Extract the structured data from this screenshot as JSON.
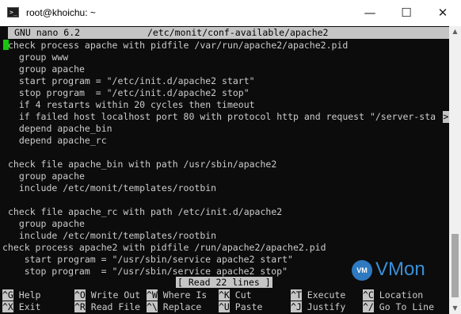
{
  "window": {
    "title": "root@khoichu: ~",
    "app_icon_glyph": ">_",
    "minimize_glyph": "—",
    "maximize_glyph": "☐",
    "close_glyph": "✕"
  },
  "nano": {
    "version": "GNU nano 6.2",
    "filename": "/etc/monit/conf-available/apache2",
    "overflow_marker": ">",
    "status_message": "[ Read 22 lines ]"
  },
  "editor_lines": [
    "check process apache with pidfile /var/run/apache2/apache2.pid",
    "  group www",
    "  group apache",
    "  start program = \"/etc/init.d/apache2 start\"",
    "  stop program  = \"/etc/init.d/apache2 stop\"",
    "  if 4 restarts within 20 cycles then timeout",
    "  if failed host localhost port 80 with protocol http and request \"/server-sta",
    "  depend apache_bin",
    "  depend apache_rc",
    "",
    "check file apache_bin with path /usr/sbin/apache2",
    "  group apache",
    "  include /etc/monit/templates/rootbin",
    "",
    "check file apache_rc with path /etc/init.d/apache2",
    "  group apache",
    "  include /etc/monit/templates/rootbin",
    "check process apache2 with pidfile /run/apache2/apache2.pid",
    "    start program = \"/usr/sbin/service apache2 start\"",
    "    stop program  = \"/usr/sbin/service apache2 stop\""
  ],
  "shortcuts": [
    {
      "key": "^G",
      "label": " Help"
    },
    {
      "key": "^O",
      "label": " Write Out"
    },
    {
      "key": "^W",
      "label": " Where Is"
    },
    {
      "key": "^K",
      "label": " Cut"
    },
    {
      "key": "^T",
      "label": " Execute"
    },
    {
      "key": "^C",
      "label": " Location"
    },
    {
      "key": "^X",
      "label": " Exit"
    },
    {
      "key": "^R",
      "label": " Read File"
    },
    {
      "key": "^\\",
      "label": " Replace"
    },
    {
      "key": "^U",
      "label": " Paste"
    },
    {
      "key": "^J",
      "label": " Justify"
    },
    {
      "key": "^/",
      "label": " Go To Line"
    }
  ],
  "watermark": {
    "badge": "VM",
    "text": "VMon"
  },
  "colors": {
    "terminal_bg": "#0c0c0c",
    "text": "#cccccc",
    "highlight_bg": "#c5c5c5",
    "cursor": "#16c60c",
    "watermark": "#3a8fd9"
  }
}
